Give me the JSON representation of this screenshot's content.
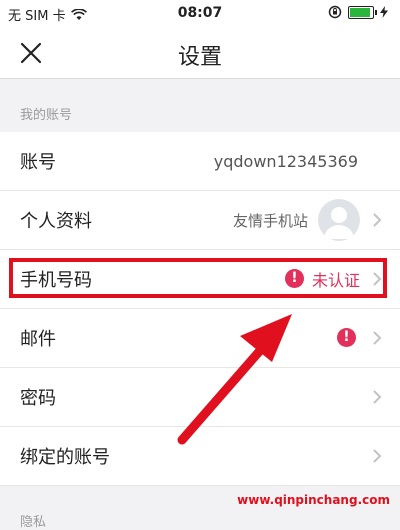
{
  "statusbar": {
    "carrier": "无 SIM 卡",
    "time": "08:07",
    "battery_level": 0.85
  },
  "navbar": {
    "title": "设置",
    "close_icon": "close-icon"
  },
  "sections": {
    "account_header": "我的账号",
    "privacy_header": "隐私"
  },
  "rows": {
    "account": {
      "label": "账号",
      "value": "yqdown12345369"
    },
    "profile": {
      "label": "个人资料",
      "value": "友情手机站"
    },
    "phone": {
      "label": "手机号码",
      "value": "未认证"
    },
    "email": {
      "label": "邮件"
    },
    "password": {
      "label": "密码"
    },
    "bound": {
      "label": "绑定的账号"
    }
  },
  "watermark": "www.qinpinchang.com",
  "colors": {
    "warning": "#e3305b",
    "annotation": "#e0101e",
    "background": "#f2f2f4"
  }
}
